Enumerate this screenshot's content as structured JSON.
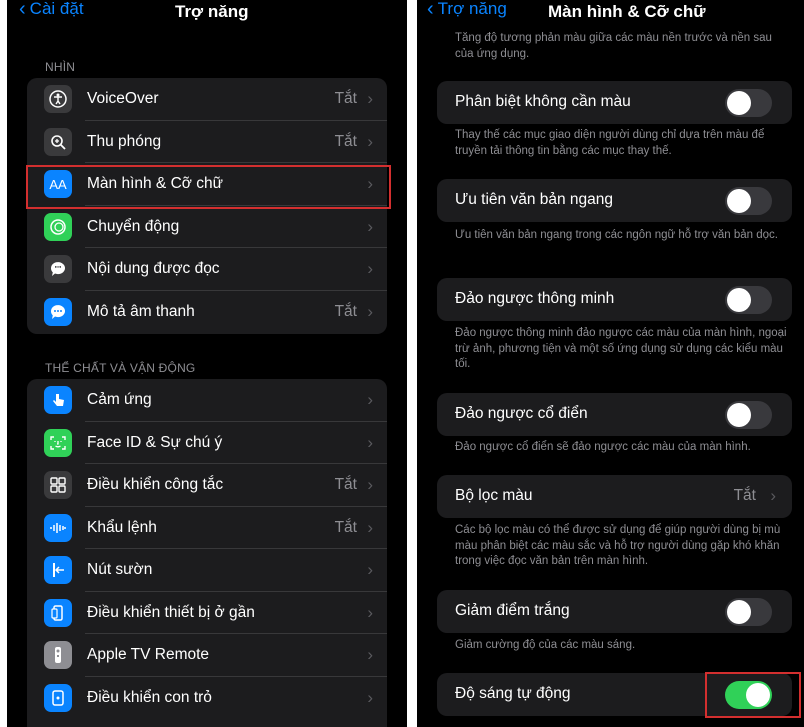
{
  "left": {
    "back_label": "Cài đặt",
    "title": "Trợ năng",
    "section_vision": "NHÌN",
    "vision_items": [
      {
        "label": "VoiceOver",
        "value": "Tắt",
        "icon": "voiceover-icon",
        "color": "#3a3a3c"
      },
      {
        "label": "Thu phóng",
        "value": "Tắt",
        "icon": "zoom-icon",
        "color": "#3a3a3c"
      },
      {
        "label": "Màn hình & Cỡ chữ",
        "value": "",
        "icon": "text-size-icon",
        "color": "#0a84ff"
      },
      {
        "label": "Chuyển động",
        "value": "",
        "icon": "motion-icon",
        "color": "#30d158"
      },
      {
        "label": "Nội dung được đọc",
        "value": "",
        "icon": "spoken-content-icon",
        "color": "#3a3a3c"
      },
      {
        "label": "Mô tả âm thanh",
        "value": "Tắt",
        "icon": "audio-description-icon",
        "color": "#0a84ff"
      }
    ],
    "section_physical": "THỂ CHẤT VÀ VẬN ĐỘNG",
    "physical_items": [
      {
        "label": "Cảm ứng",
        "value": "",
        "icon": "touch-icon",
        "color": "#0a84ff"
      },
      {
        "label": "Face ID & Sự chú ý",
        "value": "",
        "icon": "face-id-icon",
        "color": "#30d158"
      },
      {
        "label": "Điều khiển công tắc",
        "value": "Tắt",
        "icon": "switch-control-icon",
        "color": "#3a3a3c"
      },
      {
        "label": "Khẩu lệnh",
        "value": "Tắt",
        "icon": "voice-control-icon",
        "color": "#0a84ff"
      },
      {
        "label": "Nút sườn",
        "value": "",
        "icon": "side-button-icon",
        "color": "#0a84ff"
      },
      {
        "label": "Điều khiển thiết bị ở gần",
        "value": "",
        "icon": "nearby-devices-icon",
        "color": "#0a84ff"
      },
      {
        "label": "Apple TV Remote",
        "value": "",
        "icon": "tv-remote-icon",
        "color": "#8e8e93"
      },
      {
        "label": "Điều khiển con trỏ",
        "value": "",
        "icon": "pointer-control-icon",
        "color": "#0a84ff"
      }
    ]
  },
  "right": {
    "back_label": "Trợ năng",
    "title": "Màn hình & Cỡ chữ",
    "top_desc": "Tăng độ tương phản màu giữa các màu nền trước và nền sau của ứng dụng.",
    "items": [
      {
        "label": "Phân biệt không cần màu",
        "desc": "Thay thế các mục giao diện người dùng chỉ dựa trên màu để truyền tải thông tin bằng các mục thay thế.",
        "toggle_on": false
      },
      {
        "label": "Ưu tiên văn bản ngang",
        "desc": "Ưu tiên văn bản ngang trong các ngôn ngữ hỗ trợ văn bản dọc.",
        "toggle_on": false
      },
      {
        "label": "Đảo ngược thông minh",
        "desc": "Đảo ngược thông minh đảo ngược các màu của màn hình, ngoại trừ ảnh, phương tiện và một số ứng dụng sử dụng các kiểu màu tối.",
        "toggle_on": false
      },
      {
        "label": "Đảo ngược cổ điển",
        "desc": "Đảo ngược cổ điển sẽ đảo ngược các màu của màn hình.",
        "toggle_on": false
      },
      {
        "label": "Bộ lọc màu",
        "value": "Tắt",
        "desc": "Các bộ lọc màu có thể được sử dụng để giúp người dùng bị mù màu phân biệt các màu sắc và hỗ trợ người dùng gặp khó khăn trong việc đọc văn bản trên màn hình."
      },
      {
        "label": "Giảm điểm trắng",
        "desc": "Giảm cường độ của các màu sáng.",
        "toggle_on": false
      },
      {
        "label": "Độ sáng tự động",
        "desc": "",
        "toggle_on": true
      }
    ]
  },
  "colors": {
    "accent": "#0a84ff",
    "toggle_on": "#30d158",
    "highlight": "#d32f2f"
  }
}
